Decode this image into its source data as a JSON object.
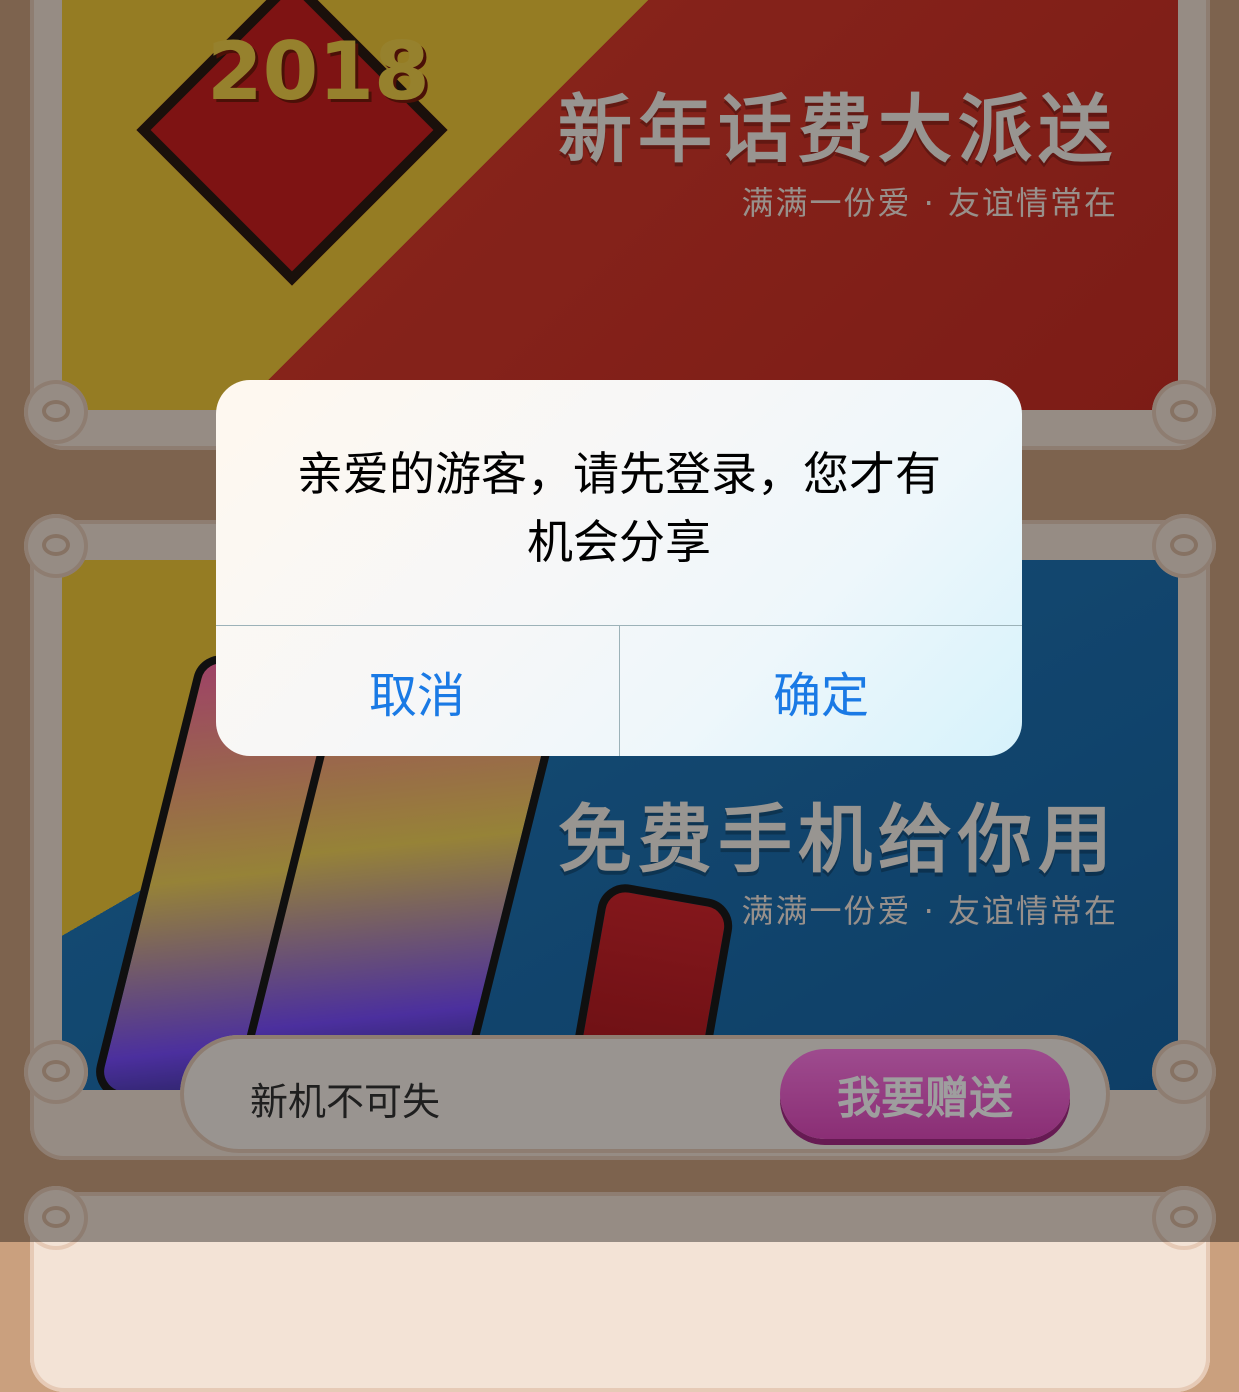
{
  "cards": [
    {
      "headline": "新年话费大派送",
      "subtitle": "满满一份爱 · 友谊情常在",
      "year": "2018"
    },
    {
      "headline": "免费手机给你用",
      "subtitle": "满满一份爱 · 友谊情常在",
      "footer_text": "新机不可失",
      "cta_label": "我要赠送"
    }
  ],
  "alert": {
    "message": "亲爱的游客，请先登录，您才有机会分享",
    "cancel_label": "取消",
    "confirm_label": "确定"
  },
  "colors": {
    "accent": "#1a7ae5",
    "cta": "#e04bbd",
    "page_bg": "#caa07e"
  }
}
